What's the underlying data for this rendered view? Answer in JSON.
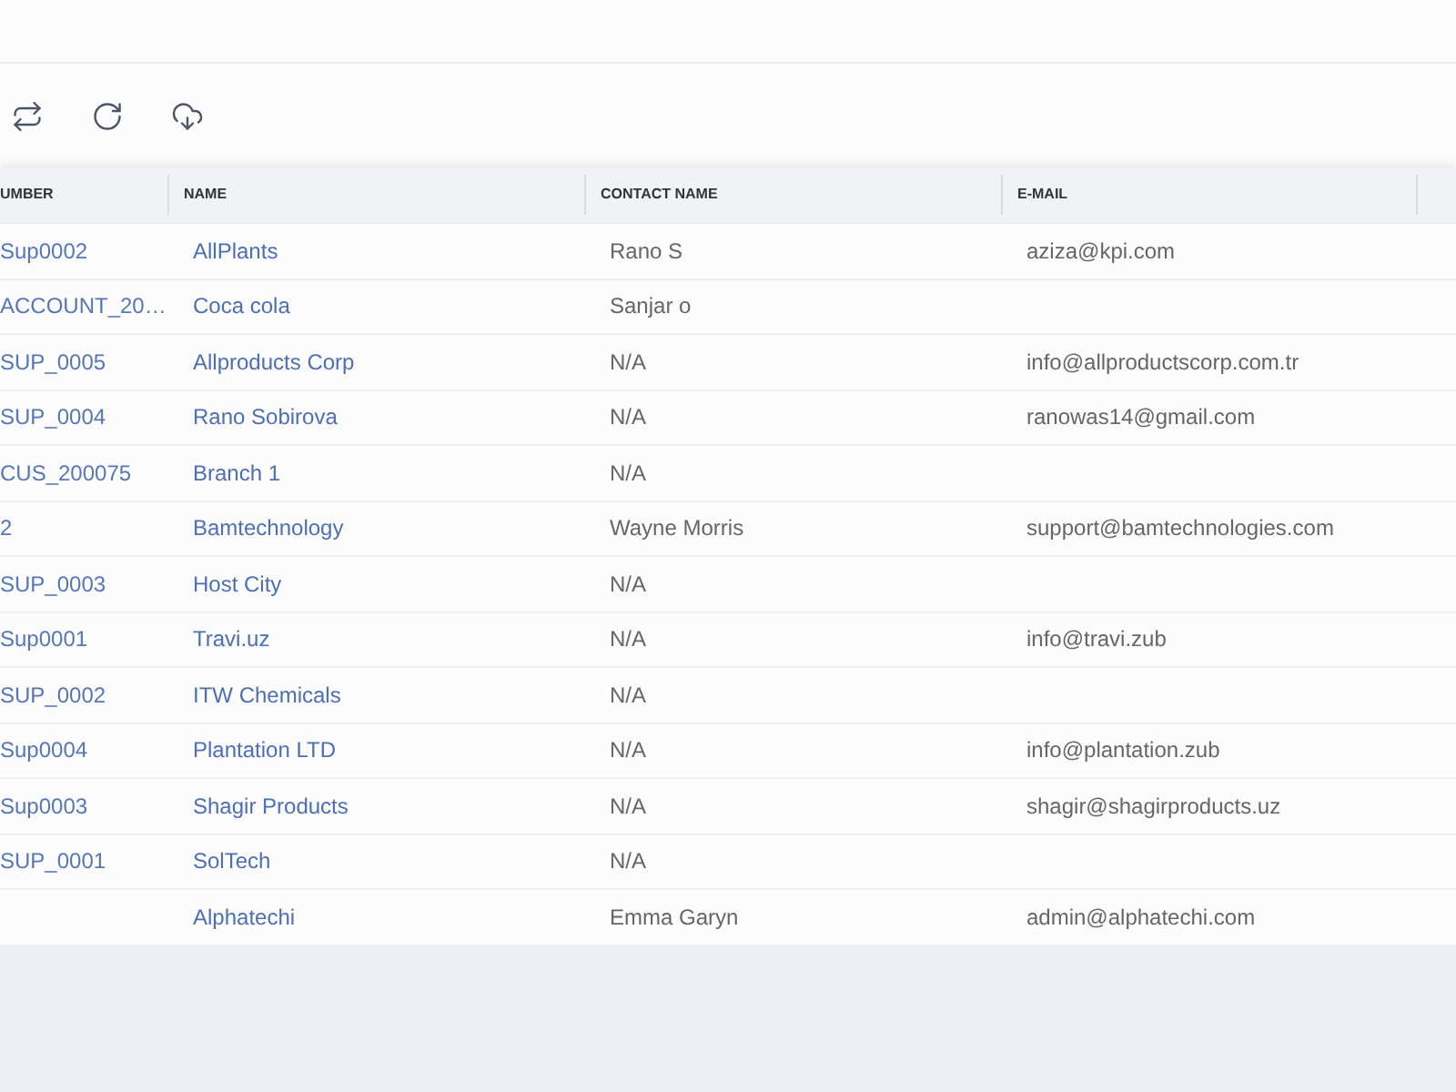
{
  "toolbar": {
    "buttons": [
      {
        "kind": "swap"
      },
      {
        "kind": "refresh"
      },
      {
        "kind": "download"
      }
    ]
  },
  "table": {
    "columns": [
      "UMBER",
      "NAME",
      "CONTACT NAME",
      "E-MAIL"
    ],
    "rows": [
      {
        "number": "Sup0002",
        "name": "AllPlants",
        "contact_name": "Rano S",
        "email": "aziza@kpi.com"
      },
      {
        "number": "ACCOUNT_20…",
        "name": "Coca cola",
        "contact_name": "Sanjar o"
      },
      {
        "number": "SUP_0005",
        "name": "Allproducts Corp",
        "contact_name": "N/A",
        "email": "info@allproductscorp.com.tr"
      },
      {
        "number": "SUP_0004",
        "name": "Rano Sobirova",
        "contact_name": "N/A",
        "email": "ranowas14@gmail.com"
      },
      {
        "number": "CUS_200075",
        "name": "Branch 1",
        "contact_name": "N/A"
      },
      {
        "number": "2",
        "name": "Bamtechnology",
        "contact_name": "Wayne Morris",
        "email": "support@bamtechnologies.com"
      },
      {
        "number": "SUP_0003",
        "name": "Host City",
        "contact_name": "N/A"
      },
      {
        "number": "Sup0001",
        "name": "Travi.uz",
        "contact_name": "N/A",
        "email": "info@travi.zub"
      },
      {
        "number": "SUP_0002",
        "name": "ITW Chemicals",
        "contact_name": "N/A"
      },
      {
        "number": "Sup0004",
        "name": "Plantation LTD",
        "contact_name": "N/A",
        "email": "info@plantation.zub"
      },
      {
        "number": "Sup0003",
        "name": "Shagir Products",
        "contact_name": "N/A",
        "email": "shagir@shagirproducts.uz"
      },
      {
        "number": "SUP_0001",
        "name": "SolTech",
        "contact_name": "N/A"
      },
      {
        "name": "Alphatechi",
        "contact_name": "Emma Garyn",
        "email": "admin@alphatechi.com"
      }
    ]
  }
}
